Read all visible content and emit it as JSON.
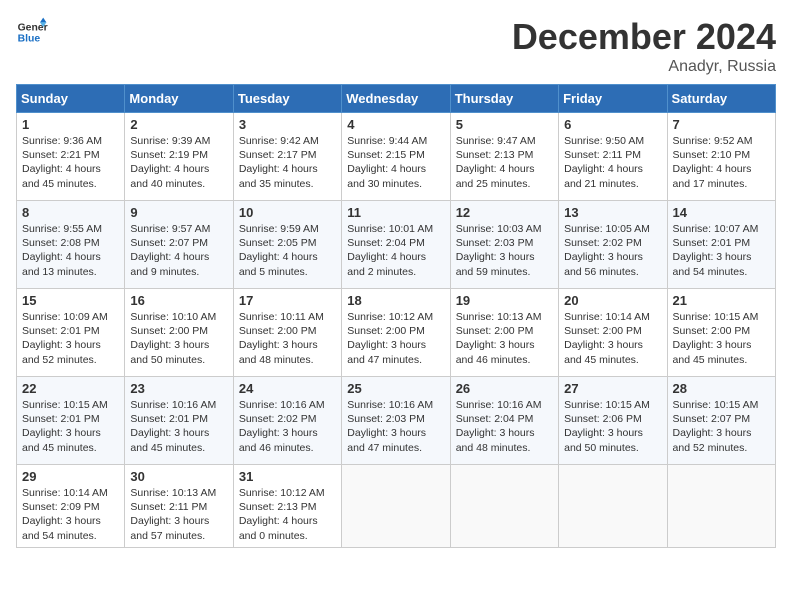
{
  "header": {
    "logo_line1": "General",
    "logo_line2": "Blue",
    "month": "December 2024",
    "location": "Anadyr, Russia"
  },
  "days_of_week": [
    "Sunday",
    "Monday",
    "Tuesday",
    "Wednesday",
    "Thursday",
    "Friday",
    "Saturday"
  ],
  "weeks": [
    [
      {
        "day": "1",
        "info": "Sunrise: 9:36 AM\nSunset: 2:21 PM\nDaylight: 4 hours\nand 45 minutes."
      },
      {
        "day": "2",
        "info": "Sunrise: 9:39 AM\nSunset: 2:19 PM\nDaylight: 4 hours\nand 40 minutes."
      },
      {
        "day": "3",
        "info": "Sunrise: 9:42 AM\nSunset: 2:17 PM\nDaylight: 4 hours\nand 35 minutes."
      },
      {
        "day": "4",
        "info": "Sunrise: 9:44 AM\nSunset: 2:15 PM\nDaylight: 4 hours\nand 30 minutes."
      },
      {
        "day": "5",
        "info": "Sunrise: 9:47 AM\nSunset: 2:13 PM\nDaylight: 4 hours\nand 25 minutes."
      },
      {
        "day": "6",
        "info": "Sunrise: 9:50 AM\nSunset: 2:11 PM\nDaylight: 4 hours\nand 21 minutes."
      },
      {
        "day": "7",
        "info": "Sunrise: 9:52 AM\nSunset: 2:10 PM\nDaylight: 4 hours\nand 17 minutes."
      }
    ],
    [
      {
        "day": "8",
        "info": "Sunrise: 9:55 AM\nSunset: 2:08 PM\nDaylight: 4 hours\nand 13 minutes."
      },
      {
        "day": "9",
        "info": "Sunrise: 9:57 AM\nSunset: 2:07 PM\nDaylight: 4 hours\nand 9 minutes."
      },
      {
        "day": "10",
        "info": "Sunrise: 9:59 AM\nSunset: 2:05 PM\nDaylight: 4 hours\nand 5 minutes."
      },
      {
        "day": "11",
        "info": "Sunrise: 10:01 AM\nSunset: 2:04 PM\nDaylight: 4 hours\nand 2 minutes."
      },
      {
        "day": "12",
        "info": "Sunrise: 10:03 AM\nSunset: 2:03 PM\nDaylight: 3 hours\nand 59 minutes."
      },
      {
        "day": "13",
        "info": "Sunrise: 10:05 AM\nSunset: 2:02 PM\nDaylight: 3 hours\nand 56 minutes."
      },
      {
        "day": "14",
        "info": "Sunrise: 10:07 AM\nSunset: 2:01 PM\nDaylight: 3 hours\nand 54 minutes."
      }
    ],
    [
      {
        "day": "15",
        "info": "Sunrise: 10:09 AM\nSunset: 2:01 PM\nDaylight: 3 hours\nand 52 minutes."
      },
      {
        "day": "16",
        "info": "Sunrise: 10:10 AM\nSunset: 2:00 PM\nDaylight: 3 hours\nand 50 minutes."
      },
      {
        "day": "17",
        "info": "Sunrise: 10:11 AM\nSunset: 2:00 PM\nDaylight: 3 hours\nand 48 minutes."
      },
      {
        "day": "18",
        "info": "Sunrise: 10:12 AM\nSunset: 2:00 PM\nDaylight: 3 hours\nand 47 minutes."
      },
      {
        "day": "19",
        "info": "Sunrise: 10:13 AM\nSunset: 2:00 PM\nDaylight: 3 hours\nand 46 minutes."
      },
      {
        "day": "20",
        "info": "Sunrise: 10:14 AM\nSunset: 2:00 PM\nDaylight: 3 hours\nand 45 minutes."
      },
      {
        "day": "21",
        "info": "Sunrise: 10:15 AM\nSunset: 2:00 PM\nDaylight: 3 hours\nand 45 minutes."
      }
    ],
    [
      {
        "day": "22",
        "info": "Sunrise: 10:15 AM\nSunset: 2:01 PM\nDaylight: 3 hours\nand 45 minutes."
      },
      {
        "day": "23",
        "info": "Sunrise: 10:16 AM\nSunset: 2:01 PM\nDaylight: 3 hours\nand 45 minutes."
      },
      {
        "day": "24",
        "info": "Sunrise: 10:16 AM\nSunset: 2:02 PM\nDaylight: 3 hours\nand 46 minutes."
      },
      {
        "day": "25",
        "info": "Sunrise: 10:16 AM\nSunset: 2:03 PM\nDaylight: 3 hours\nand 47 minutes."
      },
      {
        "day": "26",
        "info": "Sunrise: 10:16 AM\nSunset: 2:04 PM\nDaylight: 3 hours\nand 48 minutes."
      },
      {
        "day": "27",
        "info": "Sunrise: 10:15 AM\nSunset: 2:06 PM\nDaylight: 3 hours\nand 50 minutes."
      },
      {
        "day": "28",
        "info": "Sunrise: 10:15 AM\nSunset: 2:07 PM\nDaylight: 3 hours\nand 52 minutes."
      }
    ],
    [
      {
        "day": "29",
        "info": "Sunrise: 10:14 AM\nSunset: 2:09 PM\nDaylight: 3 hours\nand 54 minutes."
      },
      {
        "day": "30",
        "info": "Sunrise: 10:13 AM\nSunset: 2:11 PM\nDaylight: 3 hours\nand 57 minutes."
      },
      {
        "day": "31",
        "info": "Sunrise: 10:12 AM\nSunset: 2:13 PM\nDaylight: 4 hours\nand 0 minutes."
      },
      {
        "day": "",
        "info": ""
      },
      {
        "day": "",
        "info": ""
      },
      {
        "day": "",
        "info": ""
      },
      {
        "day": "",
        "info": ""
      }
    ]
  ]
}
